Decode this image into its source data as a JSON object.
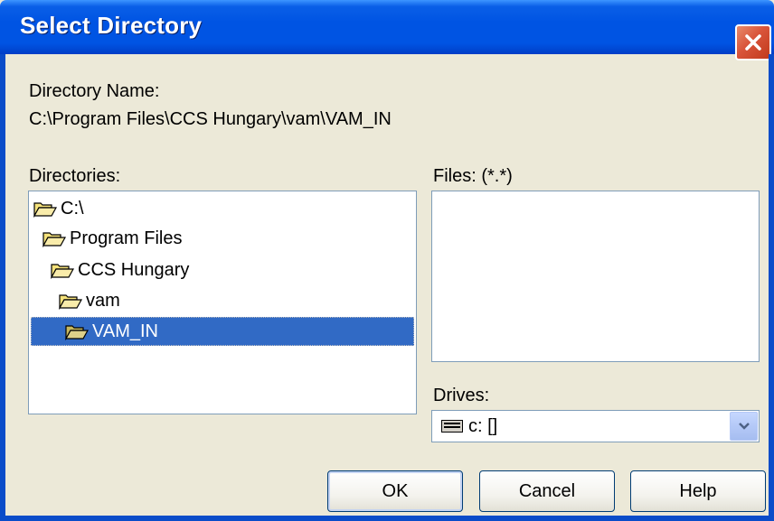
{
  "window": {
    "title": "Select Directory",
    "close_icon": "close-icon"
  },
  "directory_name": {
    "label": "Directory Name:",
    "value": "C:\\Program Files\\CCS Hungary\\vam\\VAM_IN"
  },
  "directories": {
    "label": "Directories:",
    "items": [
      {
        "label": "C:\\",
        "icon": "open-folder-icon",
        "selected": false
      },
      {
        "label": "Program Files",
        "icon": "open-folder-icon",
        "selected": false
      },
      {
        "label": "CCS Hungary",
        "icon": "open-folder-icon",
        "selected": false
      },
      {
        "label": "vam",
        "icon": "open-folder-icon",
        "selected": false
      },
      {
        "label": "VAM_IN",
        "icon": "open-folder-icon",
        "selected": true
      }
    ]
  },
  "files": {
    "label": "Files: (*.*)",
    "items": []
  },
  "drives": {
    "label": "Drives:",
    "value": "c: []",
    "icon": "drive-icon"
  },
  "buttons": {
    "ok": "OK",
    "cancel": "Cancel",
    "help": "Help"
  },
  "colors": {
    "titlebar": "#0054e3",
    "selection": "#316ac5",
    "dialog_bg": "#ece9d8"
  }
}
